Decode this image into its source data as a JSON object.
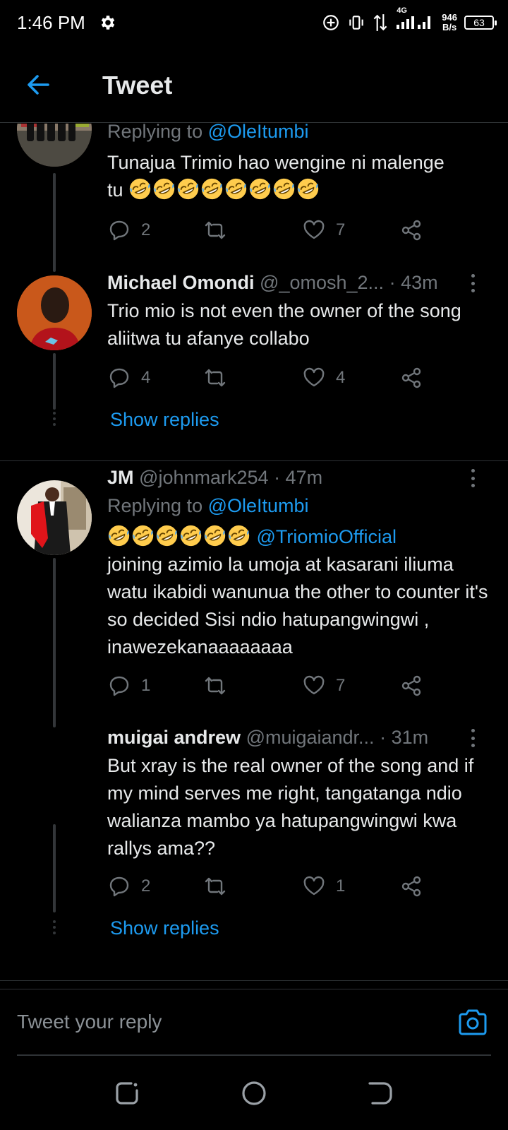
{
  "status_bar": {
    "time": "1:46 PM",
    "network_speed_value": "946",
    "network_speed_unit": "B/s",
    "network_type": "4G",
    "battery": "63",
    "icons": [
      "gear-icon",
      "hotspot-icon",
      "vibrate-icon",
      "data-arrows-icon",
      "signal-icon",
      "battery-icon"
    ]
  },
  "header": {
    "title": "Tweet",
    "back_icon": "arrow-left-icon"
  },
  "colors": {
    "accent": "#1d9bf0",
    "background": "#000000",
    "muted": "#71767b",
    "text": "#e7e9ea",
    "divider": "#2f3336"
  },
  "tweets": [
    {
      "replying_prefix": "Replying to ",
      "replying_to": "@OleItumbi",
      "text_line1": "Tunajua Trimio hao wengine ni malenge",
      "text_line2_prefix": "tu ",
      "emoji_count": 8,
      "replies": "2",
      "likes": "7"
    },
    {
      "name": "Michael Omondi",
      "handle": "@_omosh_2...",
      "time": "· 43m",
      "text": "Trio mio is not even the owner of the song aliitwa tu afanye collabo",
      "replies": "4",
      "likes": "4",
      "show_replies": "Show replies"
    },
    {
      "name": "JM",
      "handle": "@johnmark254",
      "time": "· 47m",
      "replying_prefix": "Replying to ",
      "replying_to": "@OleItumbi",
      "emoji_count": 6,
      "mention": "@TriomioOfficial",
      "text": "joining azimio la umoja at kasarani iliuma watu ikabidi wanunua the other to counter it's so decided Sisi ndio hatupangwingwi , inawezekanaaaaaaaa",
      "replies": "1",
      "likes": "7"
    },
    {
      "name": "muigai andrew",
      "handle": "@muigaiandr...",
      "time": "· 31m",
      "text": "But xray is the real owner of the song and if my mind serves me right, tangatanga ndio walianza mambo ya hatupangwingwi kwa rallys ama??",
      "replies": "2",
      "likes": "1",
      "show_replies": "Show replies"
    }
  ],
  "reply_bar": {
    "placeholder": "Tweet your reply",
    "camera_icon": "camera-icon"
  },
  "nav_bar": {
    "icons": [
      "recents-icon",
      "home-circle-icon",
      "back-nav-icon"
    ]
  }
}
